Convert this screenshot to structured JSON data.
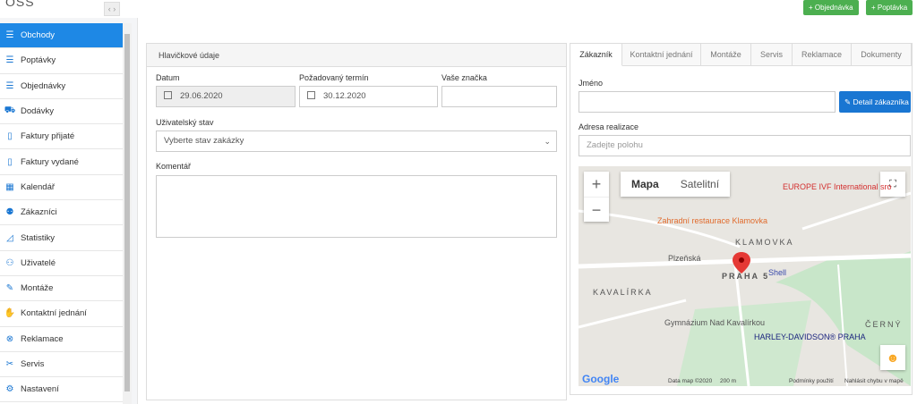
{
  "app": {
    "logo": "OSS",
    "collapse": "‹ ›"
  },
  "header": {
    "buttons": [
      "+ Objednávka",
      "+ Poptávka"
    ]
  },
  "sidebar": {
    "items": [
      {
        "label": "Obchody",
        "icon": "list-icon",
        "active": true
      },
      {
        "label": "Poptávky",
        "icon": "list-icon"
      },
      {
        "label": "Objednávky",
        "icon": "list-icon"
      },
      {
        "label": "Dodávky",
        "icon": "truck-icon"
      },
      {
        "label": "Faktury přijaté",
        "icon": "file-icon"
      },
      {
        "label": "Faktury vydané",
        "icon": "file-icon"
      },
      {
        "label": "Kalendář",
        "icon": "calendar-icon"
      },
      {
        "label": "Zákazníci",
        "icon": "users-icon"
      },
      {
        "label": "Statistiky",
        "icon": "chart-icon"
      },
      {
        "label": "Uživatelé",
        "icon": "user-icon"
      },
      {
        "label": "Montáže",
        "icon": "brush-icon"
      },
      {
        "label": "Kontaktní jednání",
        "icon": "handshake-icon"
      },
      {
        "label": "Reklamace",
        "icon": "x-circle-icon"
      },
      {
        "label": "Servis",
        "icon": "wrench-icon"
      },
      {
        "label": "Nastavení",
        "icon": "gear-icon"
      }
    ]
  },
  "form": {
    "panel_title": "Hlavičkové údaje",
    "datum_label": "Datum",
    "datum_value": "29.06.2020",
    "termin_label": "Požadovaný termín",
    "termin_value": "30.12.2020",
    "znacka_label": "Vaše značka",
    "znacka_value": "",
    "stav_label": "Uživatelský stav",
    "stav_placeholder": "Vyberte stav zakázky",
    "komentar_label": "Komentář",
    "komentar_value": ""
  },
  "tabs": [
    "Zákazník",
    "Kontaktní jednání",
    "Montáže",
    "Servis",
    "Reklamace",
    "Dokumenty"
  ],
  "customer": {
    "jmeno_label": "Jméno",
    "jmeno_value": "",
    "detail_button": "Detail zákazníka",
    "adresa_label": "Adresa realizace",
    "adresa_placeholder": "Zadejte polohu"
  },
  "map": {
    "type_map": "Mapa",
    "type_satellite": "Satelitní",
    "zoom_in": "+",
    "zoom_out": "−",
    "labels": [
      "Zahradní restaurace Klamovka",
      "KLAMOVKA",
      "PRAHA 5",
      "KAVALÍRKA",
      "Gymnázium Nad Kavalírkou",
      "EUROPE IVF International sro",
      "HARLEY-DAVIDSON® PRAHA",
      "ČERNÝ",
      "Shell",
      "Plzeňská"
    ],
    "footer": {
      "google": "Google",
      "data": "Data map ©2020",
      "scale": "200 m",
      "terms": "Podmínky použití",
      "report": "Nahlásit chybu v mapě"
    }
  }
}
